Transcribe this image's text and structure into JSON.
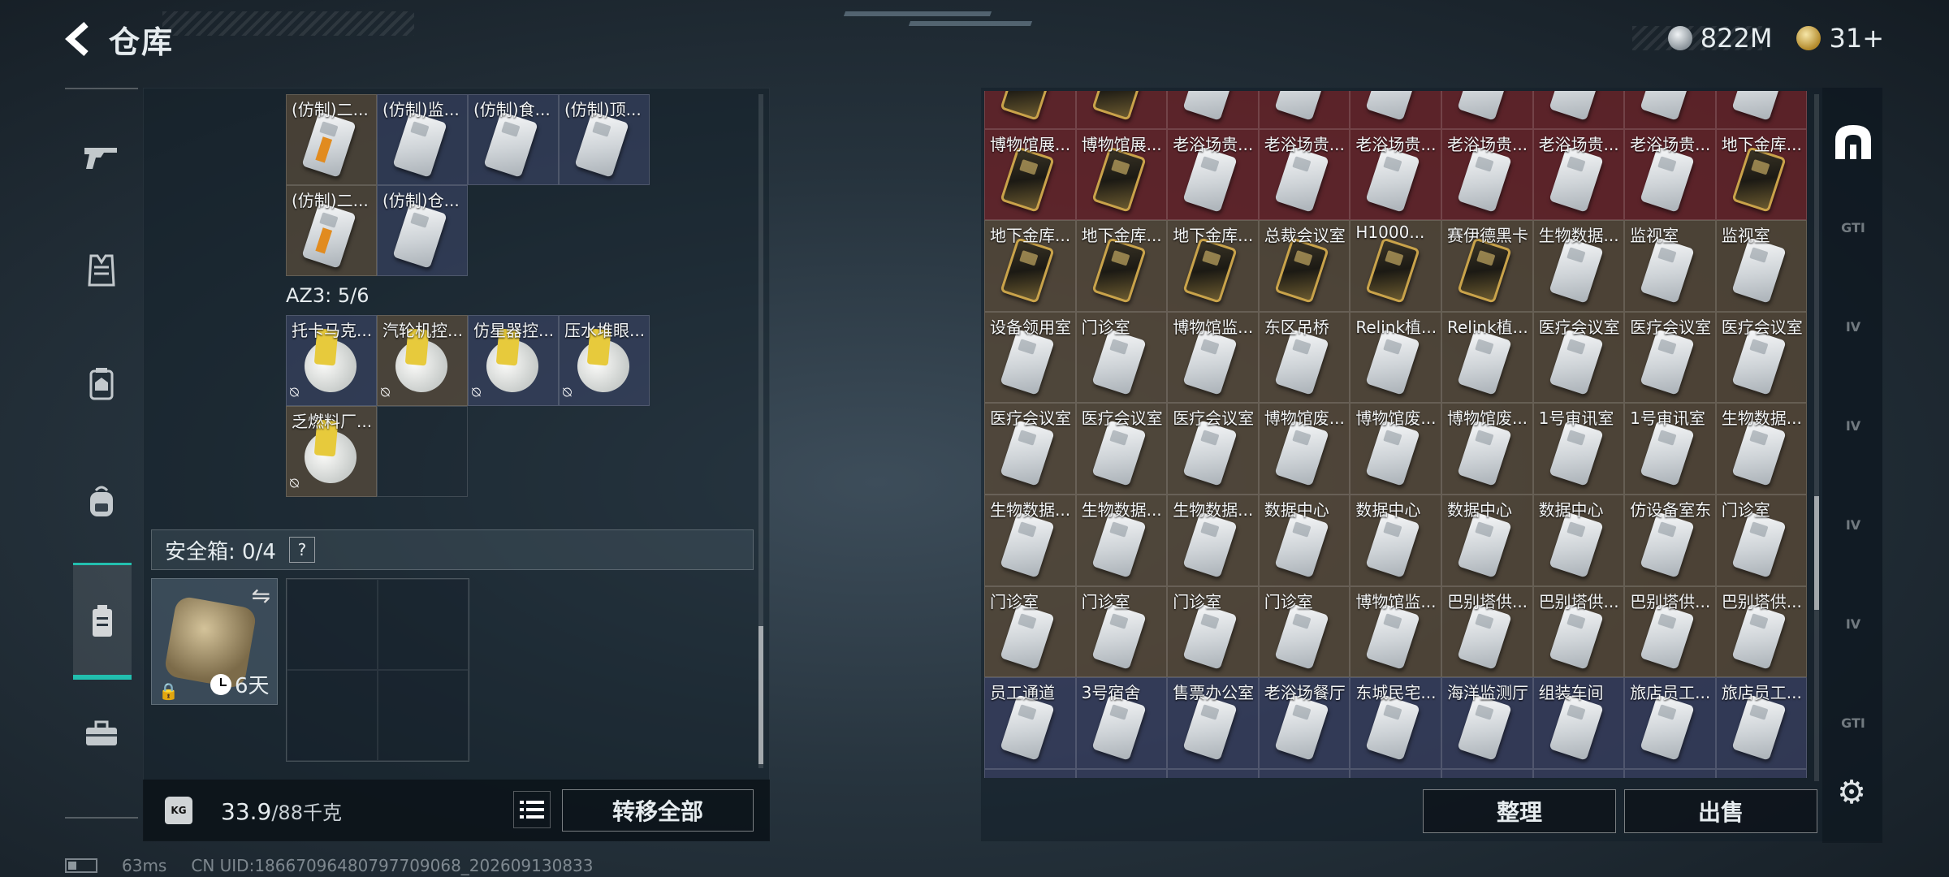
{
  "header": {
    "title": "仓库"
  },
  "currency": {
    "silver": "822M",
    "gold": "31+"
  },
  "left_nav": {
    "items": [
      "weapons",
      "armor",
      "backpack-gear",
      "backpack",
      "keycard-case",
      "toolbox"
    ],
    "active_index": 4
  },
  "container_top": {
    "row1": [
      "(仿制)二...",
      "(仿制)监...",
      "(仿制)食...",
      "(仿制)顶..."
    ],
    "row2": [
      "(仿制)二...",
      "(仿制)仓..."
    ]
  },
  "az3": {
    "label": "AZ3: 5/6",
    "items": [
      "托卡马克...",
      "汽轮机控...",
      "仿星器控...",
      "压水堆眼...",
      "乏燃料厂..."
    ]
  },
  "safe_box": {
    "label": "安全箱: 0/4",
    "help": "?",
    "days": "6天"
  },
  "bottom_left": {
    "weight_current": "33.9",
    "weight_max": "/88千克",
    "kg_icon": "KG",
    "transfer_all": "转移全部"
  },
  "stash": {
    "rows": [
      [
        "",
        "",
        "",
        "",
        "",
        "",
        "",
        "",
        ""
      ],
      [
        "博物馆展...",
        "博物馆展...",
        "老浴场贵...",
        "老浴场贵...",
        "老浴场贵...",
        "老浴场贵...",
        "老浴场贵...",
        "老浴场贵...",
        "地下金库..."
      ],
      [
        "地下金库...",
        "地下金库...",
        "地下金库...",
        "总裁会议室",
        "H1000...",
        "赛伊德黑卡",
        "生物数据...",
        "监视室",
        "监视室"
      ],
      [
        "设备领用室",
        "门诊室",
        "博物馆监...",
        "东区吊桥",
        "Relink植...",
        "Relink植...",
        "医疗会议室",
        "医疗会议室",
        "医疗会议室"
      ],
      [
        "医疗会议室",
        "医疗会议室",
        "医疗会议室",
        "博物馆废...",
        "博物馆废...",
        "博物馆废...",
        "1号审讯室",
        "1号审讯室",
        "生物数据..."
      ],
      [
        "生物数据...",
        "生物数据...",
        "生物数据...",
        "数据中心",
        "数据中心",
        "数据中心",
        "数据中心",
        "仿设备室东",
        "门诊室"
      ],
      [
        "门诊室",
        "门诊室",
        "门诊室",
        "门诊室",
        "博物馆监...",
        "巴别塔供...",
        "巴别塔供...",
        "巴别塔供...",
        "巴别塔供..."
      ],
      [
        "员工通道",
        "3号宿舍",
        "售票办公室",
        "老浴场餐厅",
        "东城民宅...",
        "海洋监测厅",
        "组装车间",
        "旅店员工...",
        "旅店员工..."
      ],
      [
        "",
        "",
        "",
        "",
        "",
        "",
        "",
        "",
        ""
      ]
    ],
    "sort": "整理",
    "sell": "出售"
  },
  "right_tabs": [
    "home",
    "GTI",
    "IV",
    "IV",
    "IV",
    "IV",
    "GTI"
  ],
  "footer": {
    "ping": "63ms",
    "uid": "CN UID:18667096480797709068_202609130833"
  }
}
